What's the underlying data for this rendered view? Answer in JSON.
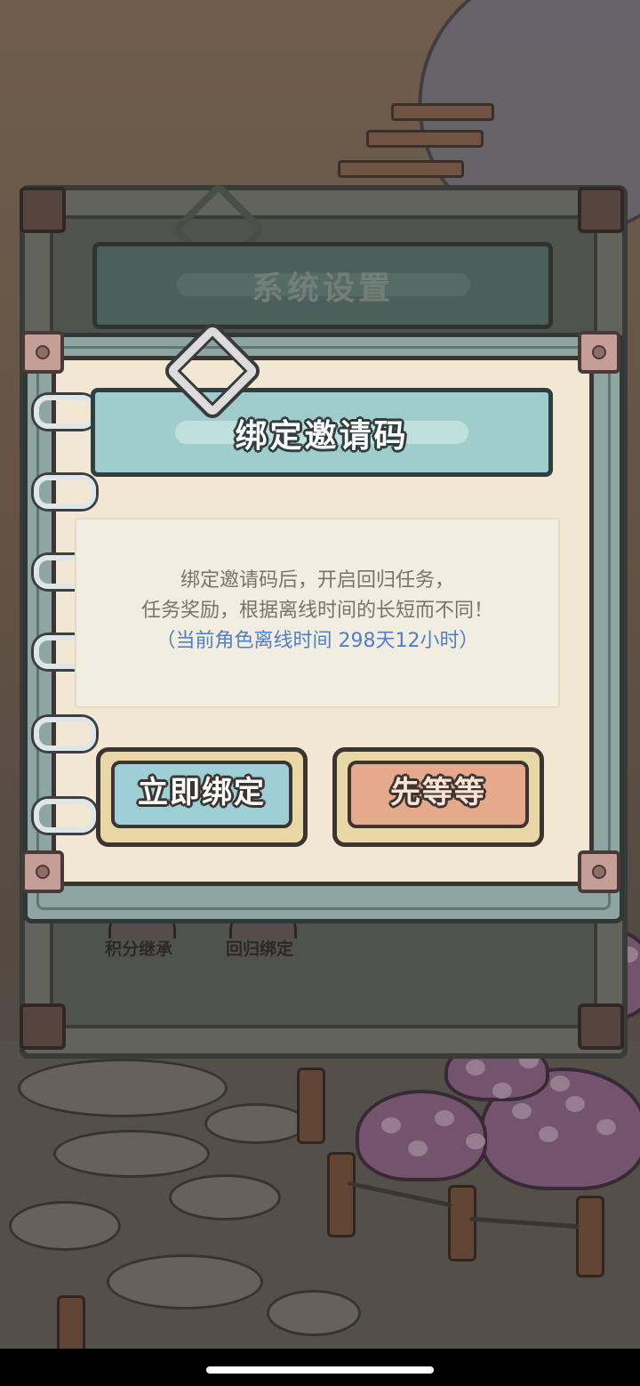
{
  "back_panel": {
    "title": "系统设置",
    "icons": [
      {
        "label": "积分继承"
      },
      {
        "label": "回归绑定"
      }
    ]
  },
  "dialog": {
    "title": "绑定邀请码",
    "message_line1": "绑定邀请码后，开启回归任务，",
    "message_line2": "任务奖励，根据离线时间的长短而不同！",
    "offline_info": "（当前角色离线时间  298天12小时）",
    "bind_button": "立即绑定",
    "wait_button": "先等等"
  },
  "colors": {
    "accent_text": "#4f7fc9",
    "title_bar": "#9fcccc",
    "bind_button": "#9ecfd6",
    "wait_button": "#e5a98c",
    "paper": "#f1e7d3"
  }
}
